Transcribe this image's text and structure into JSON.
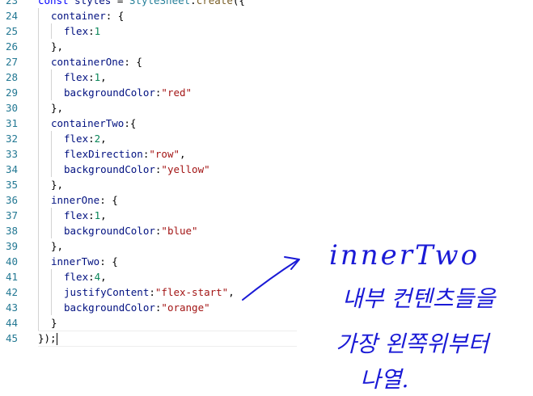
{
  "editor": {
    "lines": [
      {
        "n": "23",
        "indent": 0,
        "tokens": [
          [
            "kw",
            "const"
          ],
          [
            "p",
            " "
          ],
          [
            "var",
            "styles"
          ],
          [
            "p",
            " = "
          ],
          [
            "cls",
            "StyleSheet"
          ],
          [
            "p",
            "."
          ],
          [
            "fn",
            "create"
          ],
          [
            "p",
            "({"
          ]
        ]
      },
      {
        "n": "24",
        "indent": 1,
        "tokens": [
          [
            "prop",
            "container"
          ],
          [
            "p",
            ": {"
          ]
        ]
      },
      {
        "n": "25",
        "indent": 2,
        "tokens": [
          [
            "prop",
            "flex"
          ],
          [
            "p",
            ":"
          ],
          [
            "num",
            "1"
          ]
        ]
      },
      {
        "n": "26",
        "indent": 1,
        "tokens": [
          [
            "p",
            "},"
          ]
        ]
      },
      {
        "n": "27",
        "indent": 1,
        "tokens": [
          [
            "prop",
            "containerOne"
          ],
          [
            "p",
            ": {"
          ]
        ]
      },
      {
        "n": "28",
        "indent": 2,
        "tokens": [
          [
            "prop",
            "flex"
          ],
          [
            "p",
            ":"
          ],
          [
            "num",
            "1"
          ],
          [
            "p",
            ","
          ]
        ]
      },
      {
        "n": "29",
        "indent": 2,
        "tokens": [
          [
            "prop",
            "backgroundColor"
          ],
          [
            "p",
            ":"
          ],
          [
            "str",
            "\"red\""
          ]
        ]
      },
      {
        "n": "30",
        "indent": 1,
        "tokens": [
          [
            "p",
            "},"
          ]
        ]
      },
      {
        "n": "31",
        "indent": 1,
        "tokens": [
          [
            "prop",
            "containerTwo"
          ],
          [
            "p",
            ":{"
          ]
        ]
      },
      {
        "n": "32",
        "indent": 2,
        "tokens": [
          [
            "prop",
            "flex"
          ],
          [
            "p",
            ":"
          ],
          [
            "num",
            "2"
          ],
          [
            "p",
            ","
          ]
        ]
      },
      {
        "n": "33",
        "indent": 2,
        "tokens": [
          [
            "prop",
            "flexDirection"
          ],
          [
            "p",
            ":"
          ],
          [
            "str",
            "\"row\""
          ],
          [
            "p",
            ","
          ]
        ]
      },
      {
        "n": "34",
        "indent": 2,
        "tokens": [
          [
            "prop",
            "backgroundColor"
          ],
          [
            "p",
            ":"
          ],
          [
            "str",
            "\"yellow\""
          ]
        ]
      },
      {
        "n": "35",
        "indent": 1,
        "tokens": [
          [
            "p",
            "},"
          ]
        ]
      },
      {
        "n": "36",
        "indent": 1,
        "tokens": [
          [
            "prop",
            "innerOne"
          ],
          [
            "p",
            ": {"
          ]
        ]
      },
      {
        "n": "37",
        "indent": 2,
        "tokens": [
          [
            "prop",
            "flex"
          ],
          [
            "p",
            ":"
          ],
          [
            "num",
            "1"
          ],
          [
            "p",
            ","
          ]
        ]
      },
      {
        "n": "38",
        "indent": 2,
        "tokens": [
          [
            "prop",
            "backgroundColor"
          ],
          [
            "p",
            ":"
          ],
          [
            "str",
            "\"blue\""
          ]
        ]
      },
      {
        "n": "39",
        "indent": 1,
        "tokens": [
          [
            "p",
            "},"
          ]
        ]
      },
      {
        "n": "40",
        "indent": 1,
        "tokens": [
          [
            "prop",
            "innerTwo"
          ],
          [
            "p",
            ": {"
          ]
        ]
      },
      {
        "n": "41",
        "indent": 2,
        "tokens": [
          [
            "prop",
            "flex"
          ],
          [
            "p",
            ":"
          ],
          [
            "num",
            "4"
          ],
          [
            "p",
            ","
          ]
        ]
      },
      {
        "n": "42",
        "indent": 2,
        "tokens": [
          [
            "prop",
            "justifyContent"
          ],
          [
            "p",
            ":"
          ],
          [
            "str",
            "\"flex-start\""
          ],
          [
            "p",
            ","
          ]
        ]
      },
      {
        "n": "43",
        "indent": 2,
        "tokens": [
          [
            "prop",
            "backgroundColor"
          ],
          [
            "p",
            ":"
          ],
          [
            "str",
            "\"orange\""
          ]
        ]
      },
      {
        "n": "44",
        "indent": 1,
        "tokens": [
          [
            "p",
            "}"
          ]
        ]
      },
      {
        "n": "45",
        "indent": 0,
        "tokens": [
          [
            "p",
            "});"
          ]
        ],
        "current": true
      }
    ]
  },
  "annotation": {
    "line1": "innerTwo",
    "line2": "내부 컨텐츠들을",
    "line3": "가장 왼쪽위부터",
    "line4": "나열.",
    "ink_color": "#1a1ad6"
  },
  "colors": {
    "keyword": "#0000ff",
    "variable": "#001080",
    "function": "#795e26",
    "class": "#267f99",
    "number": "#098658",
    "string": "#a31515",
    "line_number": "#237893"
  }
}
